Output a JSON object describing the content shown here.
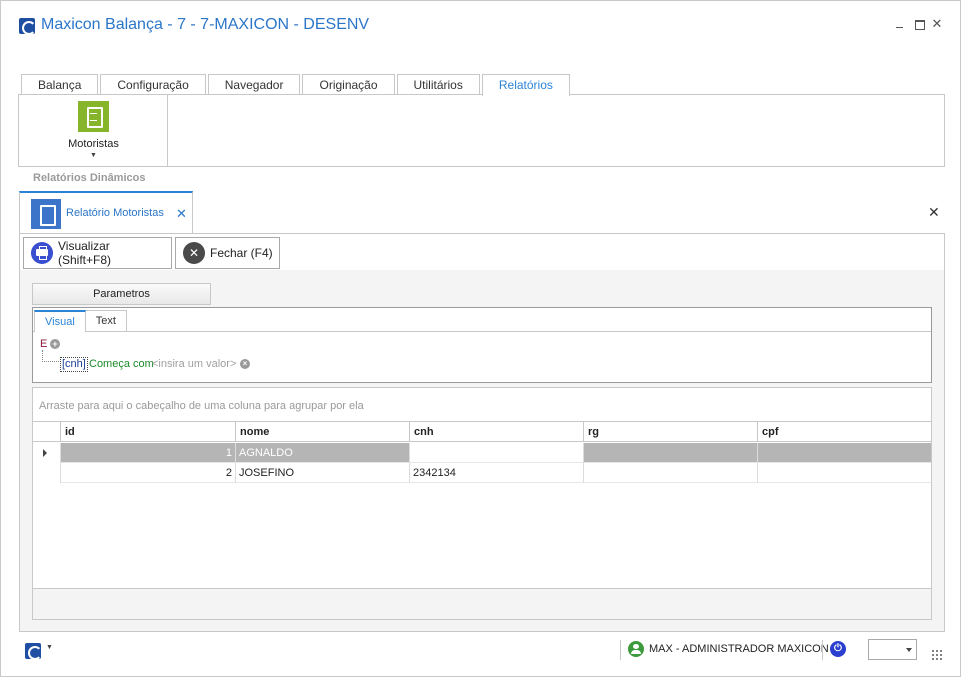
{
  "window": {
    "title": "Maxicon Balança - 7 - 7-MAXICON - DESENV",
    "controls": {
      "minimize": "",
      "maximize": "",
      "close": "✕"
    }
  },
  "ribbon": {
    "tabs": [
      "Balança",
      "Configuração",
      "Navegador",
      "Originação",
      "Utilitários",
      "Relatórios"
    ],
    "active_tab": "Relatórios",
    "buttons": [
      {
        "label": "Motoristas",
        "icon": "report-document-icon",
        "color": "#86b52c",
        "has_dropdown": true
      }
    ]
  },
  "section": {
    "label": "Relatórios Dinâmicos"
  },
  "document_tab": {
    "label": "Relatório Motoristas",
    "icon": "report-document-icon",
    "close": "✕",
    "close_all": "✕"
  },
  "toolbar": {
    "preview_label": "Visualizar (Shift+F8)",
    "close_label": "Fechar (F4)",
    "close_icon_glyph": "✕"
  },
  "parameters": {
    "button_label": "Parametros",
    "tabs": [
      "Visual",
      "Text"
    ],
    "active_tab": "Visual",
    "filter": {
      "group_operator": "E",
      "add_glyph": "+",
      "field": "[cnh]",
      "operator": "Começa com",
      "value_placeholder": "<insira um valor>",
      "remove_glyph": "×"
    }
  },
  "grid": {
    "group_panel_text": "Arraste para aqui o cabeçalho de uma coluna para agrupar por ela",
    "columns": [
      "id",
      "nome",
      "cnh",
      "rg",
      "cpf"
    ],
    "rows": [
      {
        "id": "1",
        "nome": "AGNALDO",
        "cnh": "",
        "rg": "",
        "cpf": "",
        "selected": true
      },
      {
        "id": "2",
        "nome": "JOSEFINO",
        "cnh": "2342134",
        "rg": "",
        "cpf": "",
        "selected": false
      }
    ]
  },
  "statusbar": {
    "user": "MAX - ADMINISTRADOR MAXICON",
    "power_glyph": "⏻",
    "combo_value": ""
  },
  "colors": {
    "accent": "#2b83d6",
    "title": "#2b76c9",
    "ribbon_button": "#86b52c",
    "document_icon": "#3b74c8",
    "selected_row": "#b5b5b5",
    "filter_field": "#1a3d9a",
    "filter_operator": "#1a8a2a",
    "group_operator": "#8b1a3a"
  }
}
